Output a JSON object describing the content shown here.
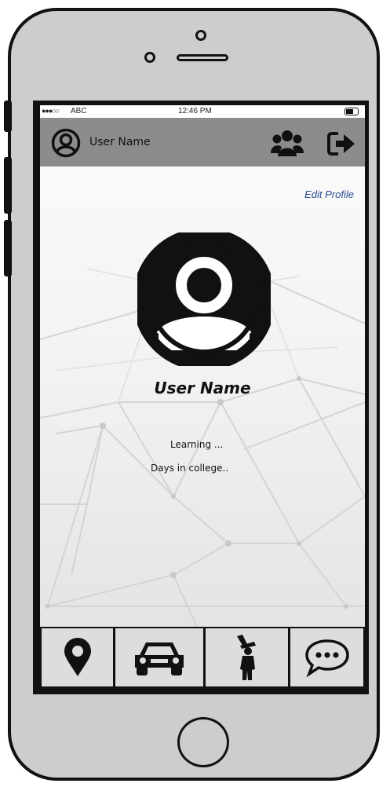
{
  "status_bar": {
    "carrier": "ABC",
    "time": "12:46 PM"
  },
  "header": {
    "user_name": "User Name"
  },
  "profile": {
    "edit_link": "Edit Profile",
    "name": "User Name",
    "line1": "Learning ...",
    "line2": "Days in college.."
  },
  "tabs": [
    {
      "icon": "location-pin-icon"
    },
    {
      "icon": "car-icon"
    },
    {
      "icon": "graduate-icon"
    },
    {
      "icon": "chat-bubble-icon"
    }
  ],
  "colors": {
    "header": "#8c8c8c",
    "link": "#2a4d8f",
    "frame": "#cdcdcd"
  }
}
